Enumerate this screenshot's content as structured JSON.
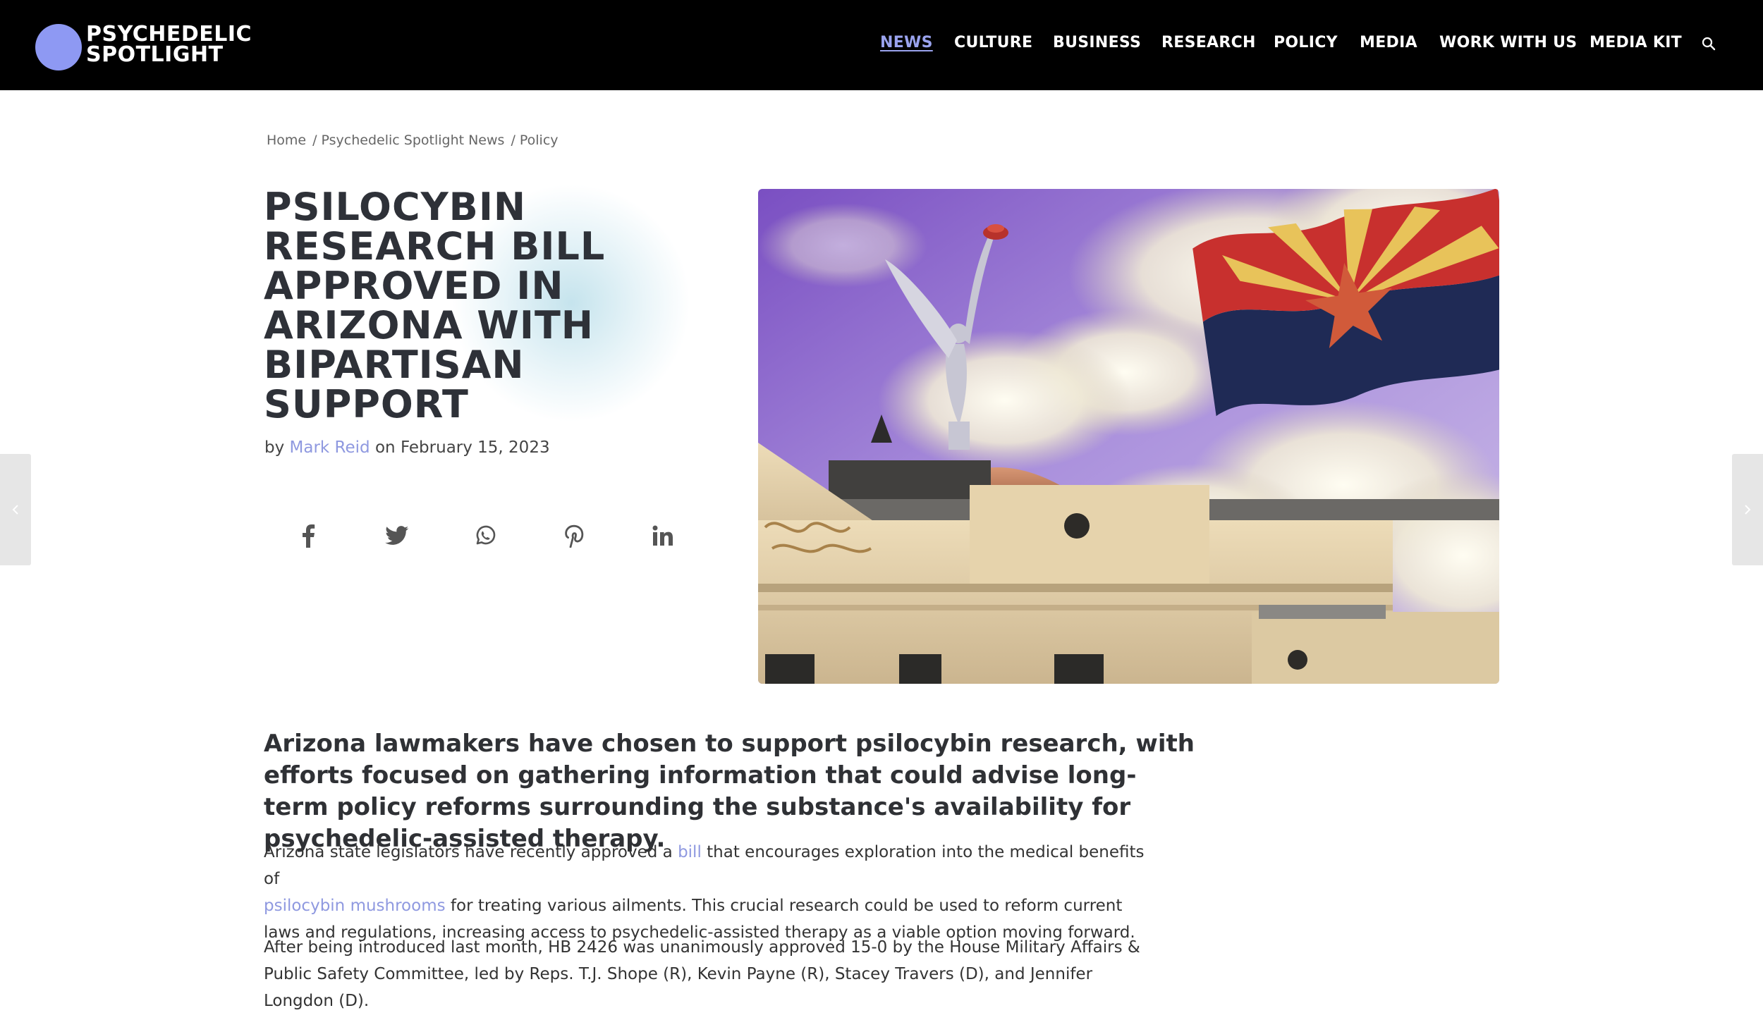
{
  "header": {
    "logo_line1": "PSYCHEDELIC",
    "logo_line2": "SPOTLIGHT",
    "nav": [
      "NEWS",
      "CULTURE",
      "BUSINESS",
      "RESEARCH",
      "POLICY",
      "MEDIA",
      "WORK WITH US",
      "MEDIA KIT"
    ],
    "active_nav": "NEWS",
    "search_icon": "search-icon"
  },
  "breadcrumb": [
    "Home",
    "Psychedelic Spotlight News",
    "Policy"
  ],
  "article": {
    "title": "PSILOCYBIN RESEARCH BILL APPROVED IN ARIZONA WITH BIPARTISAN SUPPORT",
    "by": "by",
    "author": "Mark Reid",
    "on": "on",
    "date": "February 15, 2023",
    "share_icons": [
      "facebook-icon",
      "twitter-icon",
      "whatsapp-icon",
      "pinterest-icon",
      "linkedin-icon"
    ],
    "lead": "Arizona lawmakers have chosen to support psilocybin research, with efforts focused on gathering information that could advise long-term policy reforms surrounding the substance's availability for psychedelic-assisted therapy.",
    "p1_a": "Arizona state legislators have recently approved a ",
    "p1_link1": "bill",
    "p1_b": " that encourages exploration into the medical benefits of",
    "p1_link2": "psilocybin mushrooms",
    "p1_c": " for treating various ailments. This crucial research could be used to reform current laws and regulations, increasing access to psychedelic-assisted therapy as a viable option moving forward.",
    "p2": "After being introduced last month, HB 2426 was unanimously approved 15-0 by the House Military Affairs & Public Safety Committee, led by Reps. T.J. Shope (R), Kevin Payne (R), Stacey Travers (D), and Jennifer Longdon (D)."
  },
  "colors": {
    "header_bg": "#000000",
    "accent": "#8f99e0",
    "title": "#2e3138"
  }
}
